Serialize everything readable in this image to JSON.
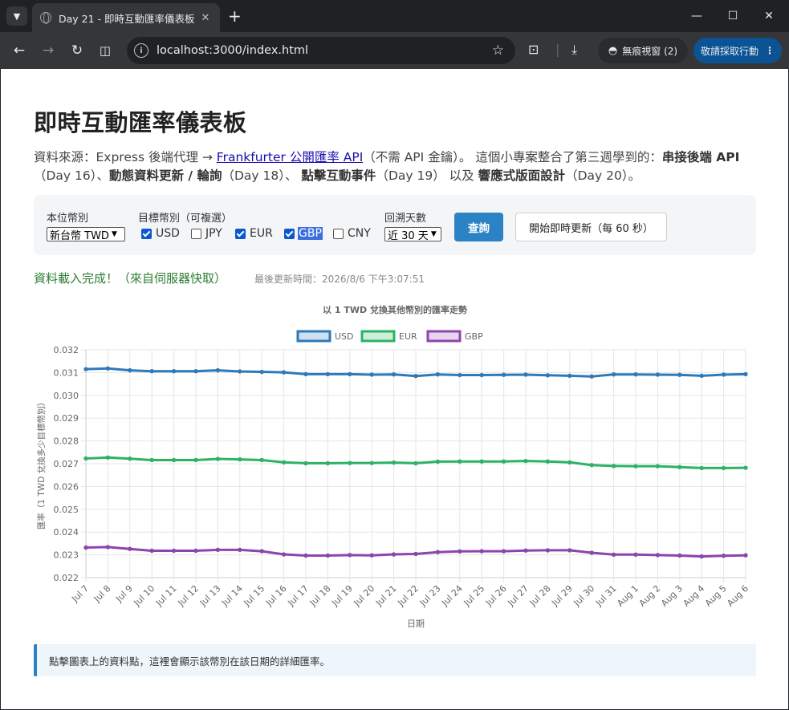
{
  "browser": {
    "tab_title": "Day 21 - 即時互動匯率儀表板",
    "url": "localhost:3000/index.html",
    "incognito_label": "無痕視窗 (2)",
    "action_label": "敬請採取行動"
  },
  "page": {
    "title": "即時互動匯率儀表板",
    "intro_prefix": "資料來源：Express 後端代理 → ",
    "intro_link": "Frankfurter 公開匯率 API",
    "intro_mid1": "（不需 API 金鑰）。 這個小專案整合了第三週學到的：",
    "intro_b1": "串接後端 API",
    "intro_mid2": "（Day 16）、",
    "intro_b2": "動態資料更新 / 輪詢",
    "intro_mid3": "（Day 18）、 ",
    "intro_b3": "點擊互動事件",
    "intro_mid4": "（Day 19） 以及 ",
    "intro_b4": "響應式版面設計",
    "intro_end": "（Day 20）。"
  },
  "controls": {
    "base_label": "本位幣別",
    "base_value": "新台幣 TWD",
    "target_label": "目標幣別（可複選）",
    "targets": [
      {
        "code": "USD",
        "checked": true
      },
      {
        "code": "JPY",
        "checked": false
      },
      {
        "code": "EUR",
        "checked": true
      },
      {
        "code": "GBP",
        "checked": true
      },
      {
        "code": "CNY",
        "checked": false
      }
    ],
    "days_label": "回溯天數",
    "days_value": "近 30 天",
    "query_button": "查詢",
    "live_button": "開始即時更新（每 60 秒）"
  },
  "status": {
    "message": "資料載入完成！（來自伺服器快取）",
    "updated": "最後更新時間：2026/8/6 下午3:07:51"
  },
  "info_box": "點擊圖表上的資料點，這裡會顯示該幣別在該日期的詳細匯率。",
  "chart_data": {
    "type": "line",
    "title": "以 1 TWD 兌換其他幣別的匯率走勢",
    "xlabel": "日期",
    "ylabel": "匯率（1 TWD 兌換多少目標幣別）",
    "ylim": [
      0.022,
      0.032
    ],
    "yticks": [
      "0.022",
      "0.023",
      "0.024",
      "0.025",
      "0.026",
      "0.027",
      "0.028",
      "0.029",
      "0.030",
      "0.031",
      "0.032"
    ],
    "grid": true,
    "legend": "top-center",
    "x": [
      "Jul 7",
      "Jul 8",
      "Jul 9",
      "Jul 10",
      "Jul 11",
      "Jul 12",
      "Jul 13",
      "Jul 14",
      "Jul 15",
      "Jul 16",
      "Jul 17",
      "Jul 18",
      "Jul 19",
      "Jul 20",
      "Jul 21",
      "Jul 22",
      "Jul 23",
      "Jul 24",
      "Jul 25",
      "Jul 26",
      "Jul 27",
      "Jul 28",
      "Jul 29",
      "Jul 30",
      "Jul 31",
      "Aug 1",
      "Aug 2",
      "Aug 3",
      "Aug 4",
      "Aug 5",
      "Aug 6"
    ],
    "series": [
      {
        "name": "USD",
        "color": "#2e7ab8",
        "fill": "#cfe0f1",
        "values": [
          0.03115,
          0.03118,
          0.0311,
          0.03106,
          0.03106,
          0.03106,
          0.0311,
          0.03105,
          0.03103,
          0.03101,
          0.03093,
          0.03093,
          0.03093,
          0.03091,
          0.03092,
          0.03085,
          0.03092,
          0.03089,
          0.03089,
          0.0309,
          0.03091,
          0.03088,
          0.03086,
          0.03083,
          0.03092,
          0.03092,
          0.03091,
          0.0309,
          0.03086,
          0.03091,
          0.03093
        ]
      },
      {
        "name": "EUR",
        "color": "#2eb266",
        "fill": "#cdeed9",
        "values": [
          0.02723,
          0.02727,
          0.02722,
          0.02716,
          0.02716,
          0.02716,
          0.02721,
          0.02719,
          0.02716,
          0.02706,
          0.02702,
          0.02702,
          0.02703,
          0.02703,
          0.02705,
          0.02702,
          0.02709,
          0.0271,
          0.0271,
          0.0271,
          0.02712,
          0.0271,
          0.02706,
          0.02694,
          0.0269,
          0.02689,
          0.02689,
          0.02685,
          0.02681,
          0.02681,
          0.02682
        ]
      },
      {
        "name": "GBP",
        "color": "#8e44ad",
        "fill": "#e7d6f0",
        "values": [
          0.02332,
          0.02334,
          0.02326,
          0.02318,
          0.02318,
          0.02318,
          0.02322,
          0.02322,
          0.02316,
          0.02302,
          0.02297,
          0.02297,
          0.02299,
          0.02298,
          0.02302,
          0.02304,
          0.02312,
          0.02315,
          0.02316,
          0.02316,
          0.02319,
          0.0232,
          0.0232,
          0.02309,
          0.02301,
          0.02301,
          0.02299,
          0.02297,
          0.02293,
          0.02296,
          0.02298
        ]
      }
    ]
  }
}
